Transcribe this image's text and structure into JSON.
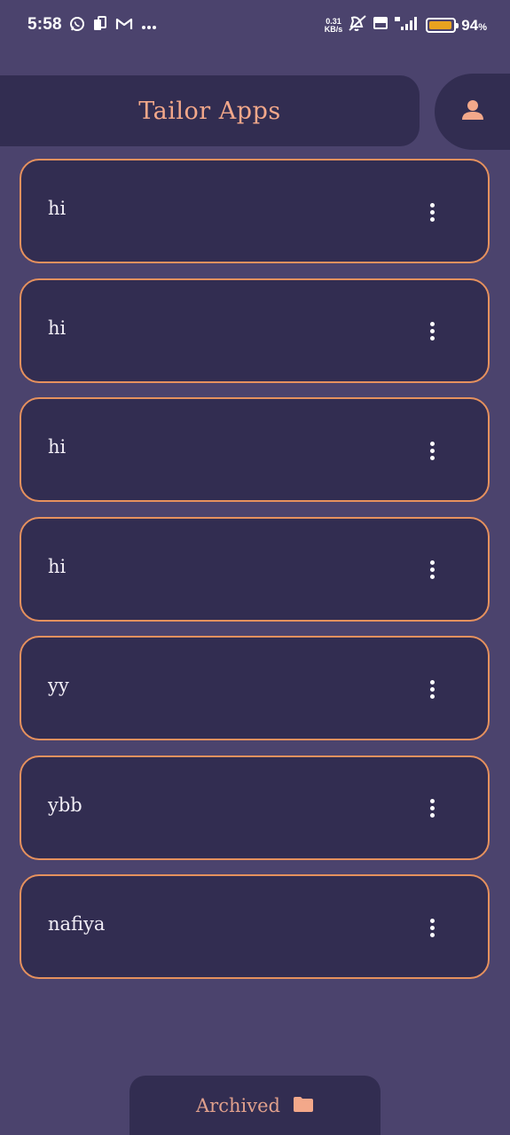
{
  "status_bar": {
    "time": "5:58",
    "notification_icons": [
      "whatsapp-icon",
      "sim-card-icon",
      "gmail-icon",
      "more-notifications-icon"
    ],
    "net_speed_value": "0.31",
    "net_speed_unit": "KB/s",
    "system_icons": [
      "vibrate-off-icon",
      "volte-icon",
      "signal-4g-icon",
      "battery-icon"
    ],
    "battery_percent": "94",
    "battery_unit": "%",
    "battery_level": 0.94,
    "battery_color": "#e8a21f"
  },
  "header": {
    "title": "Tailor Apps",
    "profile_icon": "person-icon"
  },
  "items": [
    {
      "label": "hi"
    },
    {
      "label": "hi"
    },
    {
      "label": "hi"
    },
    {
      "label": "hi"
    },
    {
      "label": "yy"
    },
    {
      "label": "ybb"
    },
    {
      "label": "nafiya"
    }
  ],
  "item_menu_icon": "more-vertical-icon",
  "archived": {
    "label": "Archived",
    "icon": "folder-icon"
  },
  "colors": {
    "background": "#4b436d",
    "surface": "#322d51",
    "accent": "#e6915e",
    "title": "#f3a88a",
    "text": "#f2eef6"
  }
}
